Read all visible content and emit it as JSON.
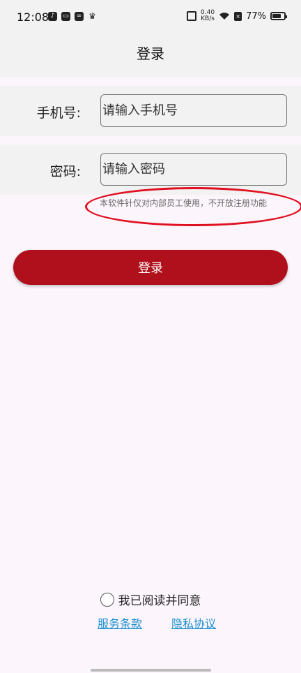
{
  "status_bar": {
    "time": "12:08",
    "left_icons": [
      "tiktok-icon",
      "inbox-icon",
      "link-icon",
      "crown-icon"
    ],
    "net_speed_value": "0.40",
    "net_speed_unit": "KB/s",
    "battery_percent": "77%",
    "battery_level": 0.77
  },
  "app_bar": {
    "title": "登录"
  },
  "form": {
    "phone": {
      "label": "手机号:",
      "placeholder": "请输入手机号"
    },
    "password": {
      "label": "密码:",
      "placeholder": "请输入密码"
    },
    "notice": "本软件针仅对内部员工使用，不开放注册功能"
  },
  "login_button": {
    "label": "登录",
    "color": "#b0101c"
  },
  "agreement": {
    "text": "我已阅读并同意",
    "terms_link": "服务条款",
    "privacy_link": "隐私协议"
  },
  "colors": {
    "annotation": "#e01020",
    "link": "#1e8fd0",
    "background": "#fcf6fc",
    "header": "#f2f2f2"
  }
}
